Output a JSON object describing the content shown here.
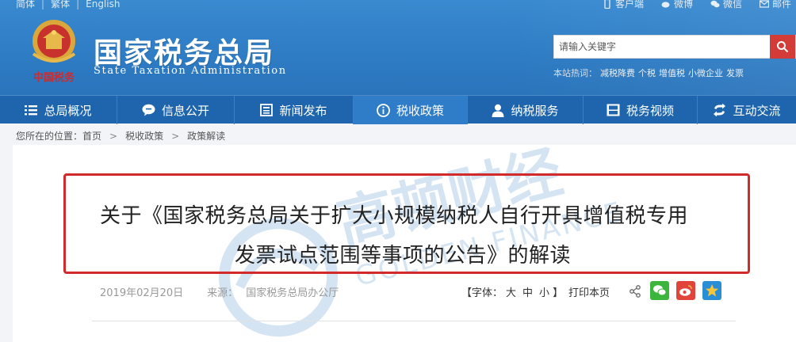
{
  "header": {
    "top_links": [
      "简体",
      "繁体",
      "English"
    ],
    "tools": [
      {
        "icon": "mobile-icon",
        "label": "客户端"
      },
      {
        "icon": "weibo-icon",
        "label": "微博"
      },
      {
        "icon": "wechat-icon",
        "label": "微信"
      },
      {
        "icon": "mail-icon",
        "label": "邮件"
      }
    ],
    "site_title": "国家税务总局",
    "site_subtitle": "State Taxation Administration",
    "emblem_caption": "中国税务",
    "search": {
      "placeholder": "请输入关键字",
      "hot_label": "本站热词：",
      "hot_words": [
        "减税降费",
        "个税",
        "增值税",
        "小微企业",
        "发票"
      ]
    }
  },
  "nav": {
    "items": [
      {
        "icon": "menu-icon",
        "label": "总局概况",
        "active": false
      },
      {
        "icon": "chat-icon",
        "label": "信息公开",
        "active": false
      },
      {
        "icon": "newspaper-icon",
        "label": "新闻发布",
        "active": false
      },
      {
        "icon": "info-icon",
        "label": "税收政策",
        "active": true
      },
      {
        "icon": "user-icon",
        "label": "纳税服务",
        "active": false
      },
      {
        "icon": "video-icon",
        "label": "税务视频",
        "active": false
      },
      {
        "icon": "exchange-icon",
        "label": "互动交流",
        "active": false
      }
    ]
  },
  "breadcrumb": {
    "prefix": "您所在的位置：",
    "items": [
      "首页",
      "税收政策",
      "政策解读"
    ]
  },
  "article": {
    "title_line1": "关于《国家税务总局关于扩大小规模纳税人自行开具增值税专用",
    "title_line2": "发票试点范围等事项的公告》的解读",
    "date": "2019年02月20日",
    "source_label": "来源：",
    "source": "国家税务总局办公厅",
    "font_label": "【字体：",
    "font_sizes": [
      "大",
      "中",
      "小"
    ],
    "font_close": "】",
    "print": "打印本页"
  },
  "watermark": {
    "brand": "高顿财经",
    "brand_en": "GOLDEN FINANCE"
  },
  "colors": {
    "header_blue": "#2e7cc4",
    "nav_blue": "#1f65ad",
    "nav_active": "#2f7cc8",
    "highlight_red": "#d22a2a",
    "search_red": "#d1302b",
    "wechat_green": "#3bb53b",
    "weibo_red": "#e0443a",
    "qzone_blue": "#2a8ed6"
  }
}
